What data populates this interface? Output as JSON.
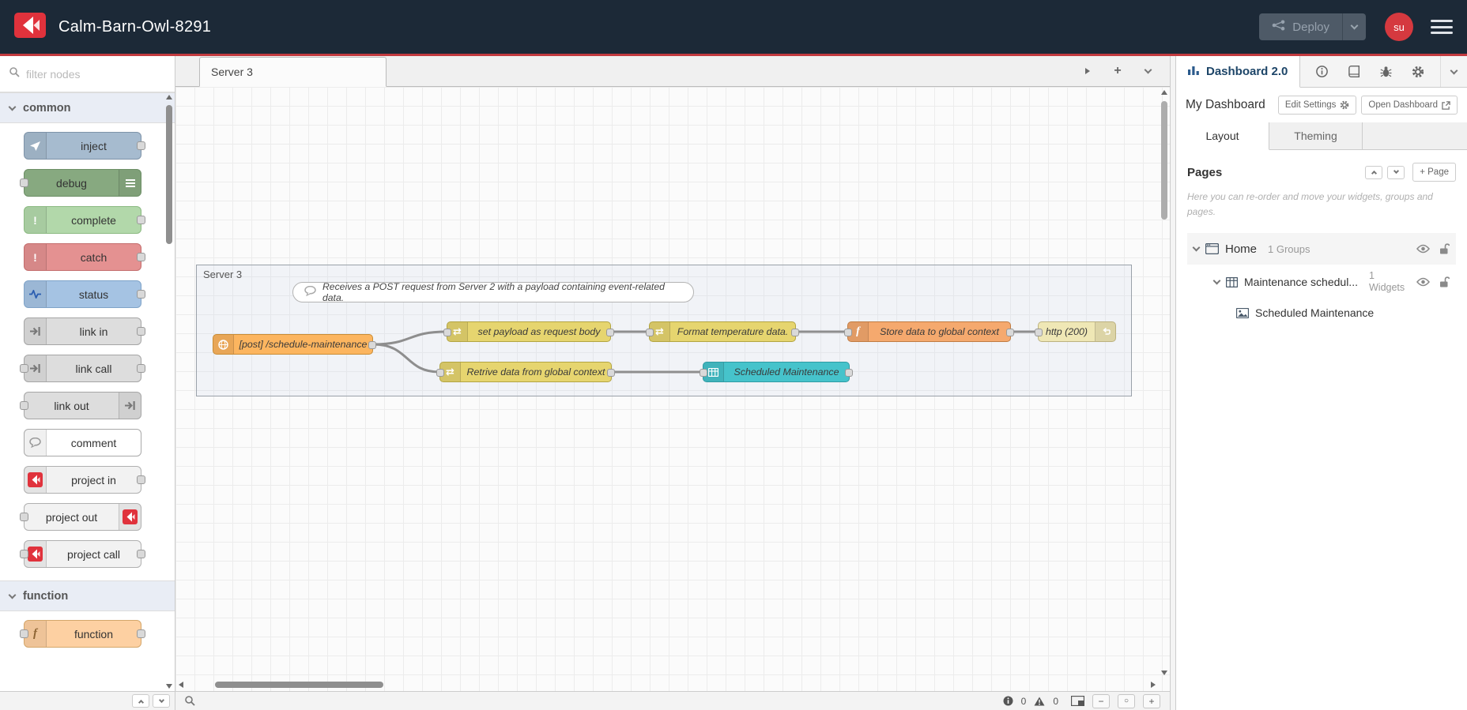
{
  "colors": {
    "header_bg": "#1c2937",
    "accent_red": "#c23a3f",
    "logo_red": "#e0323c",
    "avatar_bg": "#d5393f",
    "node_inject": "#a6bbcf",
    "node_debug": "#87a980",
    "node_complete": "#b2d8aa",
    "node_catch": "#e49191",
    "node_status": "#a5c3e3",
    "node_link": "#dddddd",
    "node_comment": "#ffffff",
    "node_project": "#f2f2f2",
    "node_function_palette": "#fdd0a2",
    "node_http_in": "#fcb55f",
    "node_change": "#e6d56f",
    "node_function_canvas": "#f5a96e",
    "node_http_response": "#efe7b5",
    "node_ui_table": "#46c3cb",
    "wire": "#8e8e8e"
  },
  "icons": {
    "plus": "+",
    "zoom_out": "−",
    "zoom_reset": "○",
    "zoom_in": "+",
    "change_arrows": "⇄",
    "exclamation": "!",
    "function_f": "f"
  },
  "header": {
    "title": "Calm-Barn-Owl-8291",
    "deploy_label": "Deploy",
    "avatar_text": "su"
  },
  "palette": {
    "search_placeholder": "filter nodes",
    "categories": [
      {
        "label": "common",
        "nodes": [
          {
            "label": "inject"
          },
          {
            "label": "debug"
          },
          {
            "label": "complete"
          },
          {
            "label": "catch"
          },
          {
            "label": "status"
          },
          {
            "label": "link in"
          },
          {
            "label": "link call"
          },
          {
            "label": "link out"
          },
          {
            "label": "comment"
          },
          {
            "label": "project in"
          },
          {
            "label": "project out"
          },
          {
            "label": "project call"
          }
        ]
      },
      {
        "label": "function",
        "nodes": [
          {
            "label": "function"
          }
        ]
      }
    ]
  },
  "workspace": {
    "active_tab": "Server 3",
    "group_label": "Server 3",
    "comment_text": "Receives a POST request from Server 2 with a payload containing event-related data.",
    "flow_nodes": [
      {
        "type": "http in",
        "label": "[post] /schedule-maintenance"
      },
      {
        "type": "change",
        "label": "set payload as request body"
      },
      {
        "type": "change",
        "label": "Format temperature data."
      },
      {
        "type": "function",
        "label": "Store data to global context"
      },
      {
        "type": "http response",
        "label": "http (200)"
      },
      {
        "type": "change",
        "label": "Retrive data from global context"
      },
      {
        "type": "ui-table",
        "label": "Scheduled Maintenance"
      }
    ],
    "footer": {
      "info_count": "0",
      "warning_count": "0"
    }
  },
  "sidebar": {
    "tab_label": "Dashboard 2.0",
    "dashboard_name": "My Dashboard",
    "edit_settings_label": "Edit Settings",
    "open_dashboard_label": "Open Dashboard",
    "tabs": [
      {
        "label": "Layout",
        "active": true
      },
      {
        "label": "Theming",
        "active": false
      }
    ],
    "pages_title": "Pages",
    "add_page_label": "+ Page",
    "help_text": "Here you can re-order and move your widgets, groups and pages.",
    "tree": {
      "page_name": "Home",
      "page_meta": "1 Groups",
      "group_name": "Maintenance schedul...",
      "group_meta": "1 Widgets",
      "widget_name": "Scheduled Maintenance"
    }
  }
}
